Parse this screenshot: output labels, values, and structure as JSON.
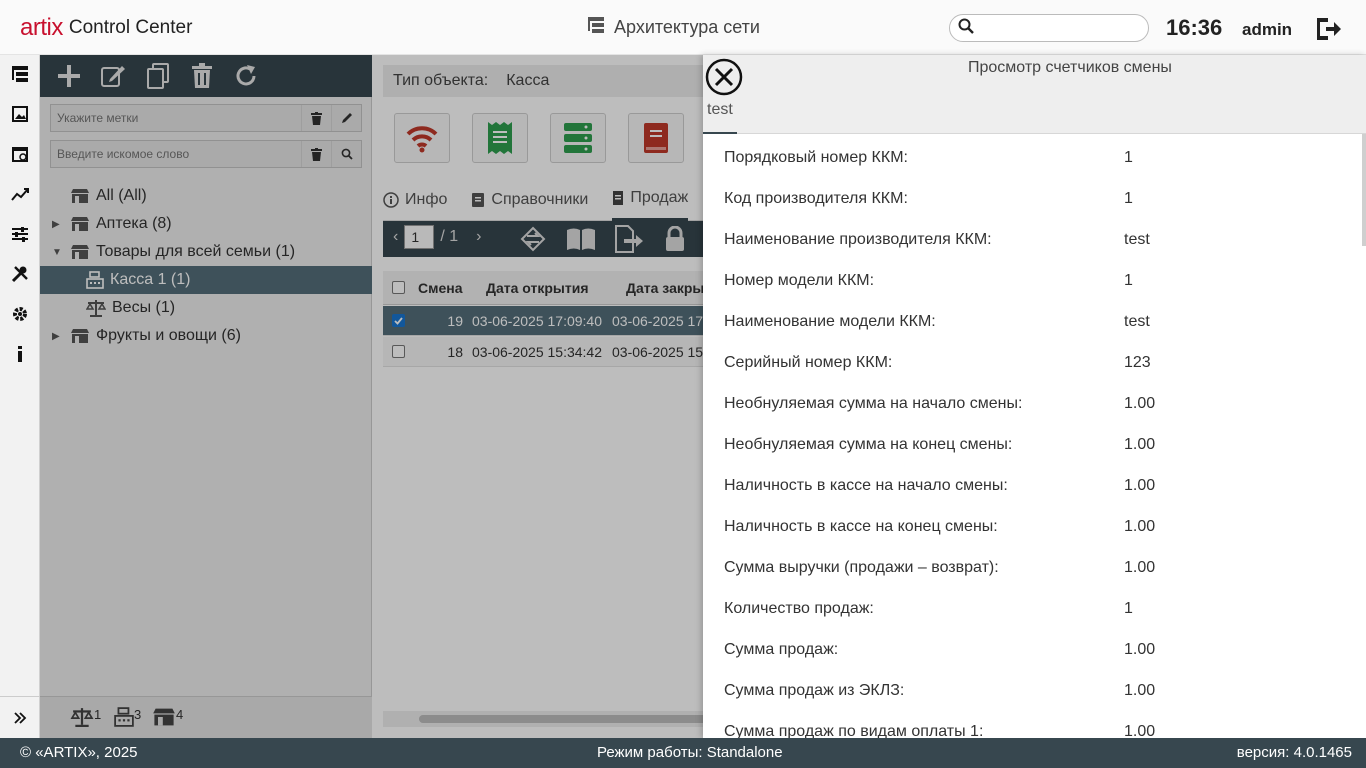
{
  "header": {
    "logo_mark": "artix",
    "logo_text": "Control Center",
    "section_title": "Архитектура сети",
    "search_placeholder": "",
    "time": "16:36",
    "user": "admin"
  },
  "tree": {
    "tags_placeholder": "Укажите метки",
    "search_placeholder": "Введите искомое слово",
    "items": [
      {
        "label": "All (All)"
      },
      {
        "label": "Аптека (8)"
      },
      {
        "label": "Товары для всей семьи (1)"
      },
      {
        "label": "Касса 1 (1)"
      },
      {
        "label": "Весы (1)"
      },
      {
        "label": "Фрукты и овощи (6)"
      }
    ],
    "bottom_counts": [
      "1",
      "3",
      "4"
    ]
  },
  "middle": {
    "type_label": "Тип объекта:",
    "type_value": "Касса",
    "tabs": [
      "Инфо",
      "Справочники",
      "Продаж"
    ],
    "page_current": "1",
    "page_total": "/ 1",
    "columns": [
      "Смена",
      "Дата открытия",
      "Дата закры"
    ],
    "rows": [
      {
        "shift": "19",
        "opened": "03-06-2025 17:09:40",
        "closed": "03-06-2025 17"
      },
      {
        "shift": "18",
        "opened": "03-06-2025 15:34:42",
        "closed": "03-06-2025 15"
      }
    ]
  },
  "modal": {
    "title": "Просмотр счетчиков смены",
    "tab": "test",
    "fields": [
      {
        "label": "Порядковый номер ККМ:",
        "value": "1"
      },
      {
        "label": "Код производителя ККМ:",
        "value": "1"
      },
      {
        "label": "Наименование производителя ККМ:",
        "value": "test"
      },
      {
        "label": "Номер модели ККМ:",
        "value": "1"
      },
      {
        "label": "Наименование модели ККМ:",
        "value": "test"
      },
      {
        "label": "Серийный номер ККМ:",
        "value": "123"
      },
      {
        "label": "Необнуляемая сумма на начало смены:",
        "value": "1.00"
      },
      {
        "label": "Необнуляемая сумма на конец смены:",
        "value": "1.00"
      },
      {
        "label": "Наличность в кассе на начало смены:",
        "value": "1.00"
      },
      {
        "label": "Наличность в кассе на конец смены:",
        "value": "1.00"
      },
      {
        "label": "Сумма выручки (продажи – возврат):",
        "value": "1.00"
      },
      {
        "label": "Количество продаж:",
        "value": "1"
      },
      {
        "label": "Сумма продаж:",
        "value": "1.00"
      },
      {
        "label": "Сумма продаж из ЭКЛЗ:",
        "value": "1.00"
      },
      {
        "label": "Сумма продаж по видам оплаты 1:",
        "value": "1.00"
      }
    ]
  },
  "footer": {
    "copyright": "© «ARTIX», 2025",
    "mode": "Режим работы: Standalone",
    "version": "версия: 4.0.1465"
  },
  "colors": {
    "dark_toolbar": "#37474f",
    "selection": "#546e7a",
    "brand_red": "#c8102e",
    "accent_green": "#2e9e4f",
    "accent_red": "#c0392b"
  }
}
